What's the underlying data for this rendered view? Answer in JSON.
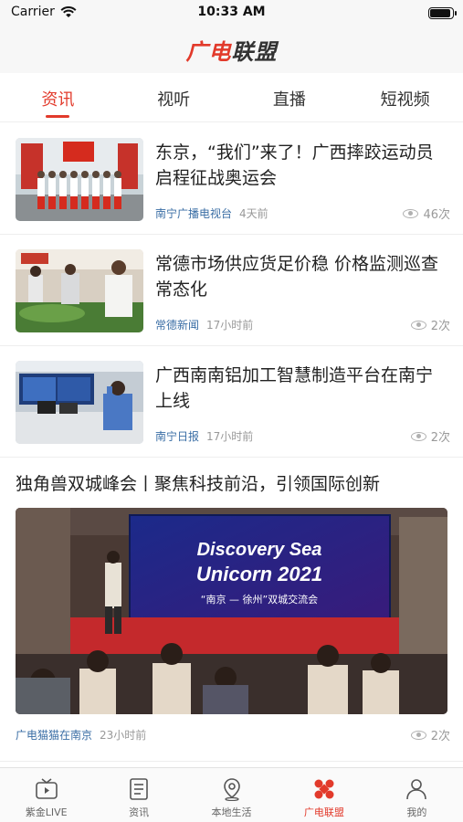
{
  "status_bar": {
    "carrier": "Carrier",
    "time": "10:33 AM",
    "battery_level": 0.95
  },
  "header": {
    "logo_part1": "广电",
    "logo_part2": "联盟"
  },
  "tabs": [
    {
      "label": "资讯",
      "active": true
    },
    {
      "label": "视听",
      "active": false
    },
    {
      "label": "直播",
      "active": false
    },
    {
      "label": "短视频",
      "active": false
    }
  ],
  "feed": [
    {
      "title": "东京，“我们”来了！广西摔跤运动员启程征战奥运会",
      "source": "南宁广播电视台",
      "time": "4天前",
      "views": "46次"
    },
    {
      "title": "常德市场供应货足价稳 价格监测巡查常态化",
      "source": "常德新闻",
      "time": "17小时前",
      "views": "2次"
    },
    {
      "title": "广西南南铝加工智慧制造平台在南宁上线",
      "source": "南宁日报",
      "time": "17小时前",
      "views": "2次"
    }
  ],
  "featured": {
    "title": "独角兽双城峰会丨聚焦科技前沿，引领国际创新",
    "screen_line1": "Discovery Sea",
    "screen_line2": "Unicorn 2021",
    "screen_line3": "“南京 — 徐州”双城交流会",
    "source": "广电猫猫在南京",
    "time": "23小时前",
    "views": "2次"
  },
  "tabbar": [
    {
      "label": "紫金LIVE",
      "icon": "tv-icon",
      "active": false
    },
    {
      "label": "资讯",
      "icon": "news-list-icon",
      "active": false
    },
    {
      "label": "本地生活",
      "icon": "location-pin-icon",
      "active": false
    },
    {
      "label": "广电联盟",
      "icon": "alliance-logo-icon",
      "active": true
    },
    {
      "label": "我的",
      "icon": "person-icon",
      "active": false
    }
  ],
  "colors": {
    "accent": "#e23a2b",
    "source_link": "#3a6ea5"
  }
}
